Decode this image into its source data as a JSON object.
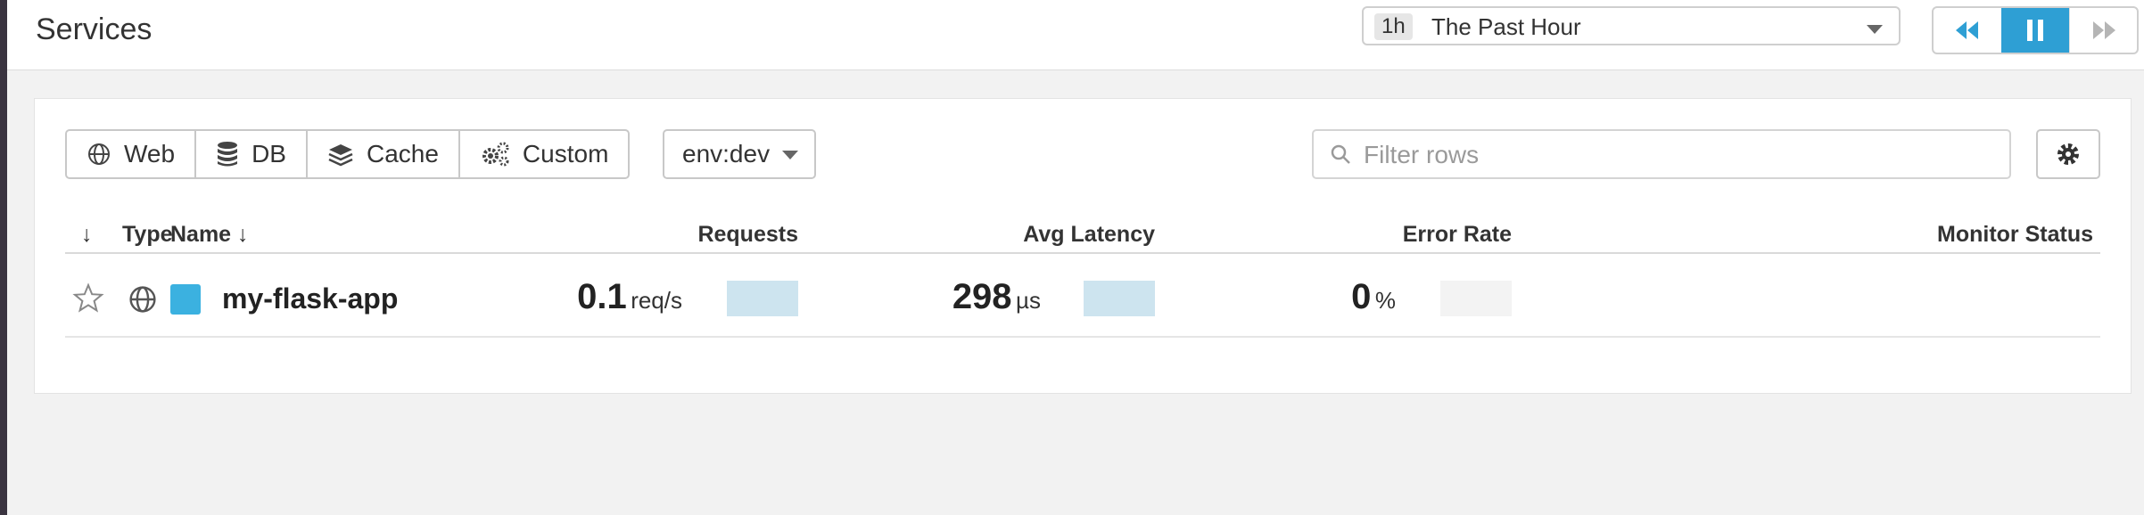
{
  "header": {
    "title": "Services",
    "timeframe": {
      "badge": "1h",
      "label": "The Past Hour"
    }
  },
  "toolbar": {
    "type_filters": [
      {
        "label": "Web",
        "icon": "globe-icon"
      },
      {
        "label": "DB",
        "icon": "database-icon"
      },
      {
        "label": "Cache",
        "icon": "layers-icon"
      },
      {
        "label": "Custom",
        "icon": "gears-icon"
      }
    ],
    "env": "env:dev",
    "filter_placeholder": "Filter rows"
  },
  "table": {
    "columns": {
      "sort": "↓",
      "type": "Type",
      "name": "Name ↓",
      "requests": "Requests",
      "latency": "Avg Latency",
      "error_rate": "Error Rate",
      "monitor": "Monitor Status"
    },
    "rows": [
      {
        "name": "my-flask-app",
        "type_icon": "globe-icon",
        "color": "#3bb1e0",
        "requests": {
          "value": "0.1",
          "unit": "req/s"
        },
        "latency": {
          "value": "298",
          "unit": "µs"
        },
        "error_rate": {
          "value": "0",
          "unit": "%"
        },
        "monitor_status": ""
      }
    ]
  },
  "colors": {
    "accent": "#2e9fd4",
    "spark_fill": "#cde4ef",
    "spark_empty": "#f3f3f3"
  }
}
